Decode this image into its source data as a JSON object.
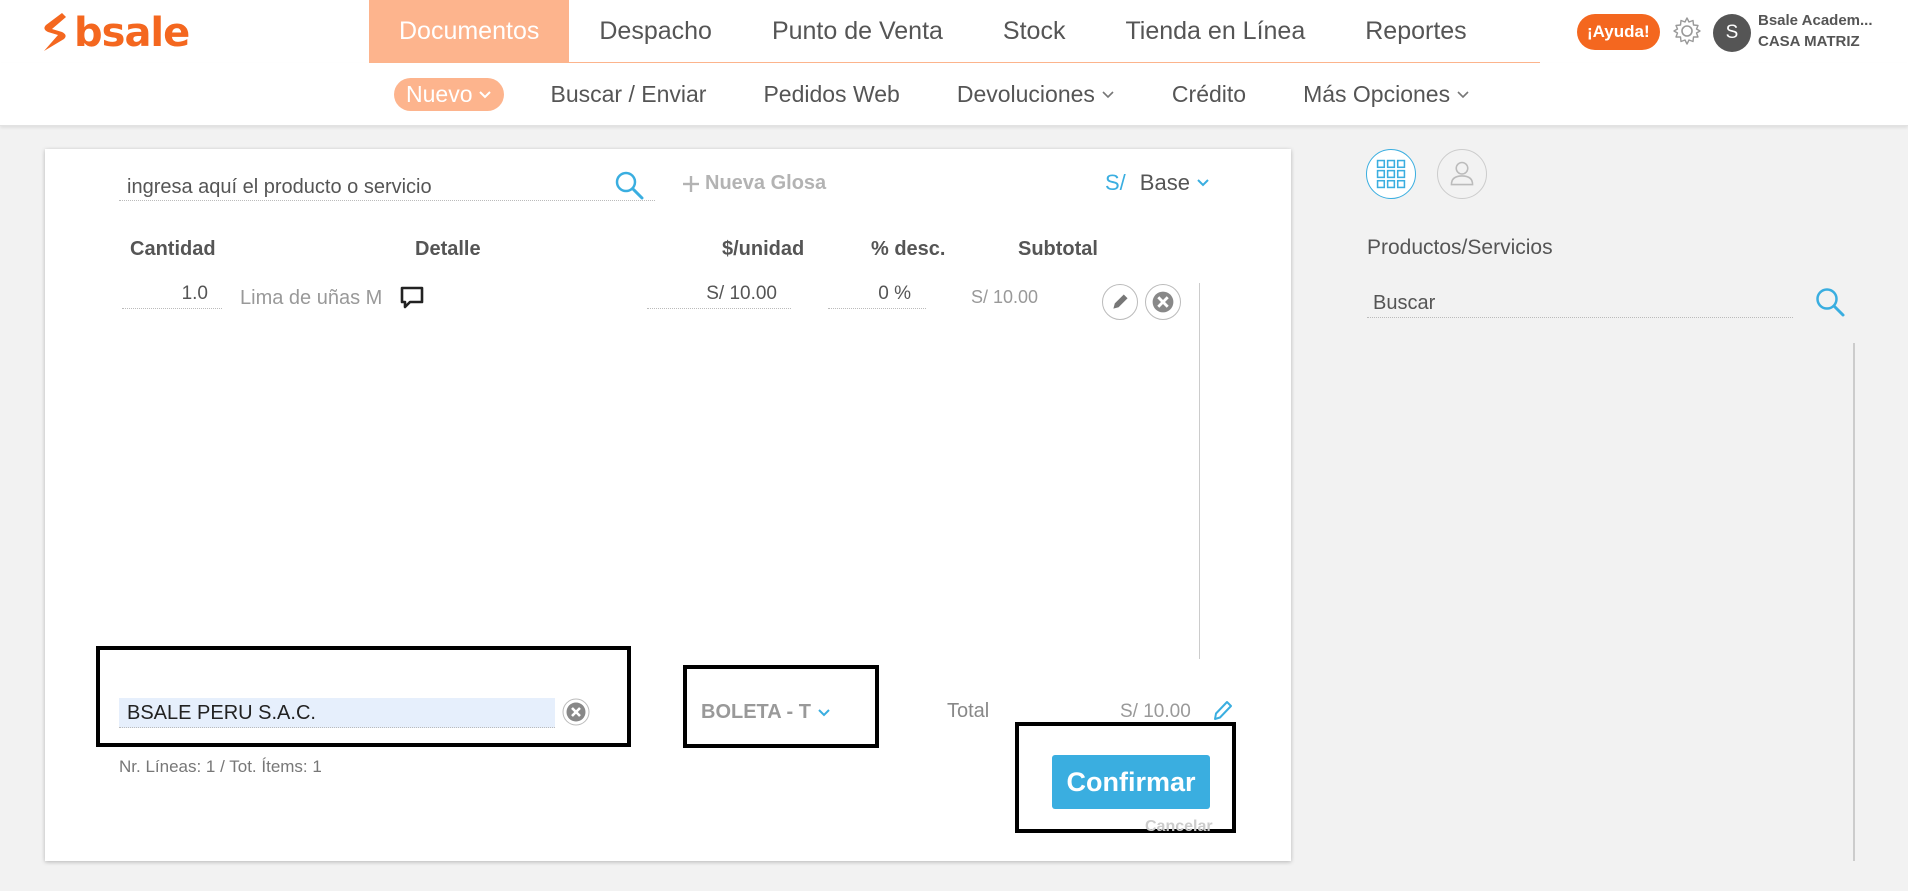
{
  "brand": {
    "name": "bsale",
    "color": "#f4671f"
  },
  "main_nav": {
    "items": [
      "Documentos",
      "Despacho",
      "Punto de Venta",
      "Stock",
      "Tienda en Línea",
      "Reportes"
    ],
    "active": "Documentos"
  },
  "header": {
    "help_label": "¡Ayuda!",
    "avatar_initial": "S",
    "user_name": "Bsale Academ...",
    "branch": "CASA MATRIZ"
  },
  "sub_nav": {
    "new_label": "Nuevo",
    "search_send": "Buscar / Enviar",
    "web_orders": "Pedidos Web",
    "returns": "Devoluciones",
    "credit": "Crédito",
    "more": "Más Opciones"
  },
  "document": {
    "product_search_placeholder": "ingresa aquí el producto o servicio",
    "new_gloss_label": "Nueva Glosa",
    "currency_symbol": "S/",
    "price_list": "Base",
    "columns": [
      "Cantidad",
      "Detalle",
      "$/unidad",
      "% desc.",
      "Subtotal"
    ],
    "lines": [
      {
        "quantity": "1.0",
        "detail": "Lima de uñas M",
        "unit_price": "S/ 10.00",
        "discount": "0 %",
        "subtotal": "S/ 10.00"
      }
    ],
    "client": "BSALE PERU S.A.C.",
    "document_type": "BOLETA - T",
    "total_label": "Total",
    "total_value": "S/ 10.00",
    "lines_info": "Nr. Líneas: 1 / Tot. Ítems: 1",
    "confirm_label": "Confirmar",
    "cancel_label": "Cancelar"
  },
  "side_panel": {
    "title": "Productos/Servicios",
    "search_placeholder": "Buscar"
  },
  "colors": {
    "accent": "#3aaee0",
    "nav_active": "#fdb48d",
    "orange": "#f4671f"
  }
}
